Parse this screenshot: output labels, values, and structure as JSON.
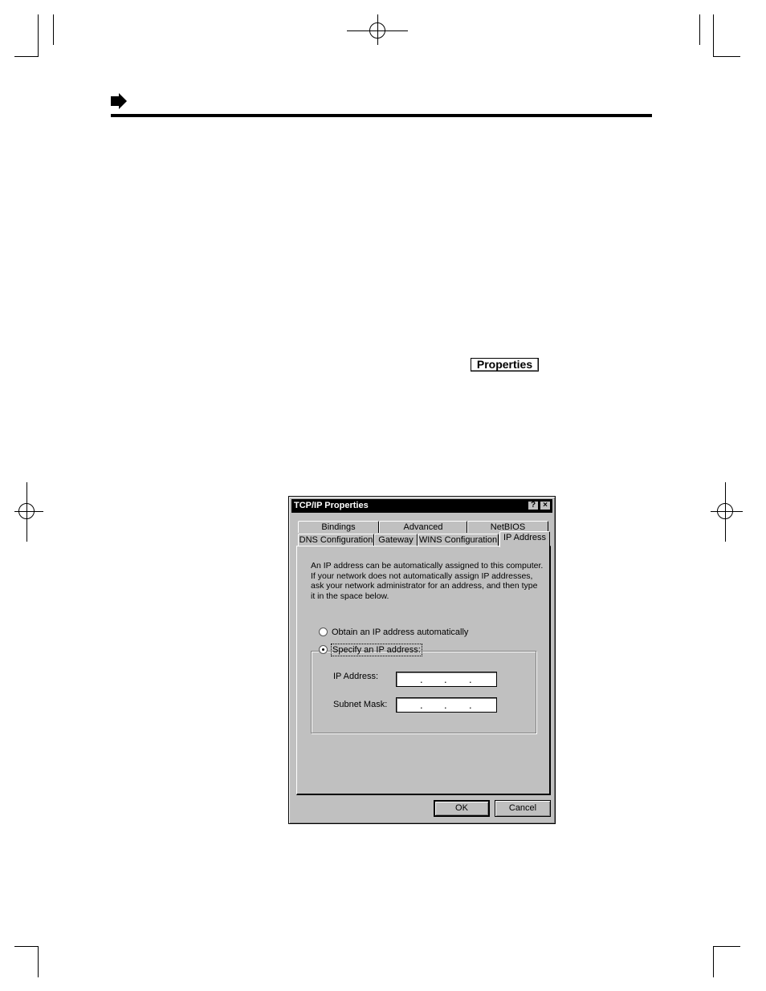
{
  "page": {
    "properties_button_label": "Properties"
  },
  "dialog": {
    "title": "TCP/IP Properties",
    "help_button": "?",
    "close_button": "×",
    "tabs_back": [
      "Bindings",
      "Advanced",
      "NetBIOS"
    ],
    "tabs_front": [
      "DNS Configuration",
      "Gateway",
      "WINS Configuration",
      "IP Address"
    ],
    "active_tab": "IP Address",
    "description": "An IP address can be automatically assigned to this computer. If your network does not automatically assign IP addresses, ask your network administrator for an address, and then type it in the space below.",
    "radio_auto": "Obtain an IP address automatically",
    "radio_specify": "Specify an IP address:",
    "selected_option": "Specify an IP address:",
    "ip_address_label": "IP Address:",
    "subnet_mask_label": "Subnet Mask:",
    "ok_button": "OK",
    "cancel_button": "Cancel"
  }
}
